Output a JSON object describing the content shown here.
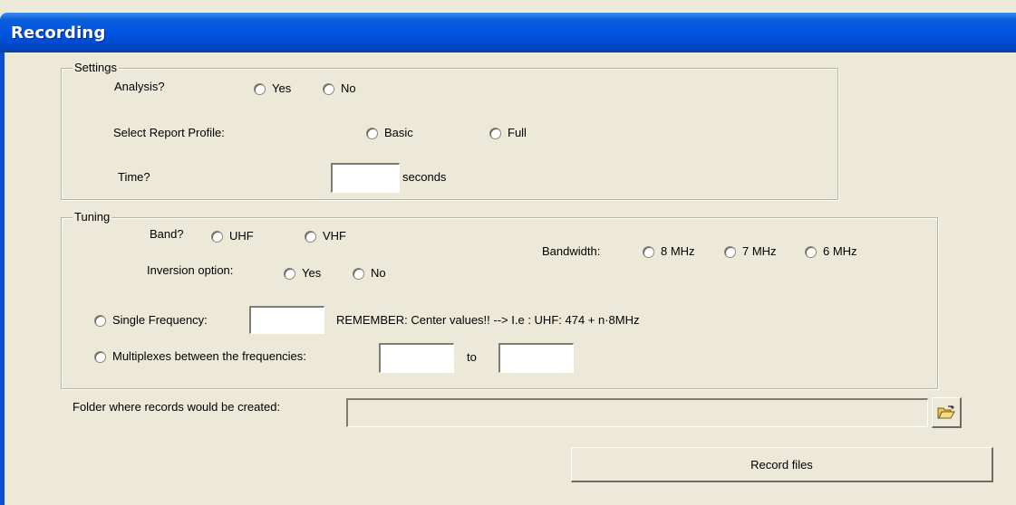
{
  "window": {
    "title": "Recording"
  },
  "settings": {
    "legend": "Settings",
    "analysis_label": "Analysis?",
    "analysis_yes": "Yes",
    "analysis_no": "No",
    "report_profile_label": "Select Report Profile:",
    "report_basic": "Basic",
    "report_full": "Full",
    "time_label": "Time?",
    "time_value": "",
    "time_unit": "seconds"
  },
  "tuning": {
    "legend": "Tuning",
    "band_label": "Band?",
    "band_uhf": "UHF",
    "band_vhf": "VHF",
    "bandwidth_label": "Bandwidth:",
    "bw_8": "8 MHz",
    "bw_7": "7 MHz",
    "bw_6": "6 MHz",
    "inversion_label": "Inversion option:",
    "inversion_yes": "Yes",
    "inversion_no": "No",
    "single_freq_label": "Single Frequency:",
    "single_freq_value": "",
    "remember_text": "REMEMBER: Center values!! --> I.e : UHF: 474 + n·8MHz",
    "multiplex_label": "Multiplexes between the frequencies:",
    "multiplex_from": "",
    "to_label": "to",
    "multiplex_to": ""
  },
  "folder": {
    "label": "Folder where records would be created:",
    "value": "",
    "browse_icon": "open-folder-icon"
  },
  "actions": {
    "record_label": "Record files"
  }
}
